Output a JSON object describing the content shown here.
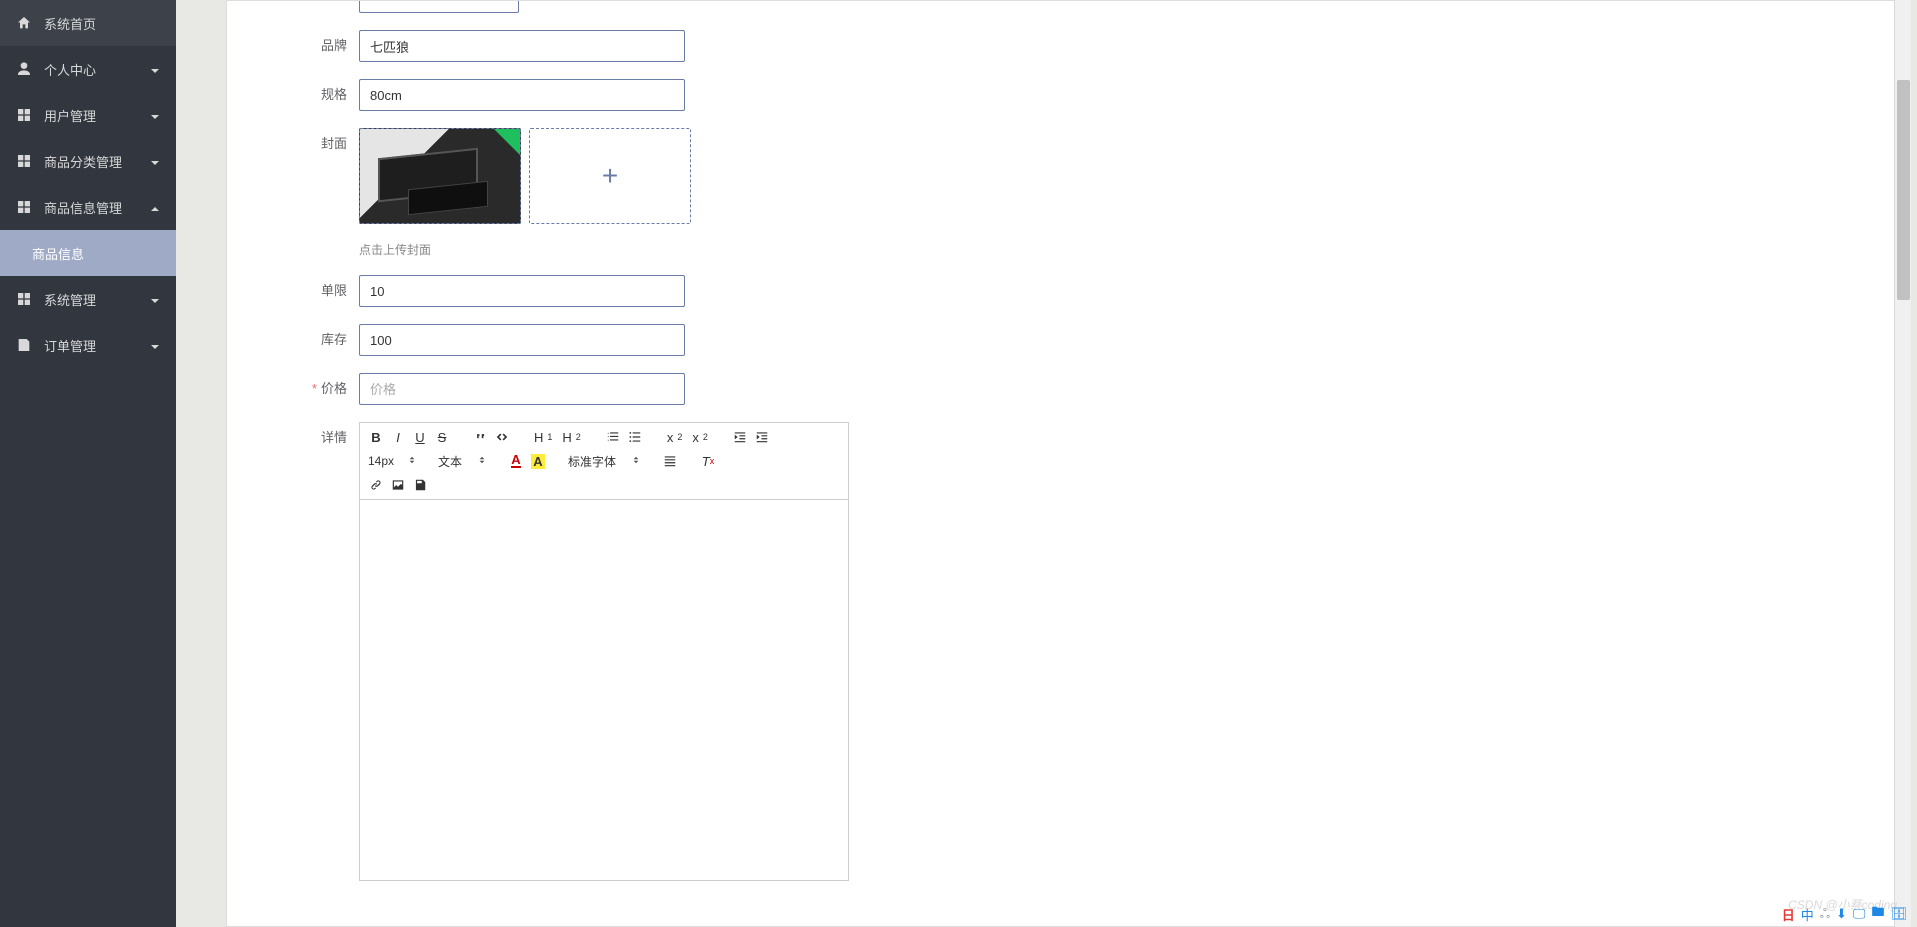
{
  "sidebar": {
    "items": [
      {
        "label": "系统首页",
        "icon": "home",
        "arrow": ""
      },
      {
        "label": "个人中心",
        "icon": "user",
        "arrow": "down"
      },
      {
        "label": "用户管理",
        "icon": "grid",
        "arrow": "down"
      },
      {
        "label": "商品分类管理",
        "icon": "grid",
        "arrow": "down"
      },
      {
        "label": "商品信息管理",
        "icon": "grid",
        "arrow": "up"
      },
      {
        "label": "商品信息",
        "icon": "",
        "arrow": "",
        "active": true
      },
      {
        "label": "系统管理",
        "icon": "grid",
        "arrow": "down"
      },
      {
        "label": "订单管理",
        "icon": "doc",
        "arrow": "down"
      }
    ]
  },
  "form": {
    "brand": {
      "label": "品牌",
      "value": "七匹狼"
    },
    "spec": {
      "label": "规格",
      "value": "80cm"
    },
    "cover": {
      "label": "封面",
      "hint": "点击上传封面"
    },
    "limit": {
      "label": "单限",
      "value": "10"
    },
    "stock": {
      "label": "库存",
      "value": "100"
    },
    "price": {
      "label": "价格",
      "placeholder": "价格",
      "required": true
    },
    "detail": {
      "label": "详情"
    }
  },
  "editor": {
    "font_size": "14px",
    "block": "文本",
    "font_family": "标准字体"
  },
  "watermark": "CSDN @小蔡coding",
  "tray": [
    "日",
    "中",
    "ஃ",
    "⬇",
    "🖵",
    "🖿",
    "🗄"
  ]
}
